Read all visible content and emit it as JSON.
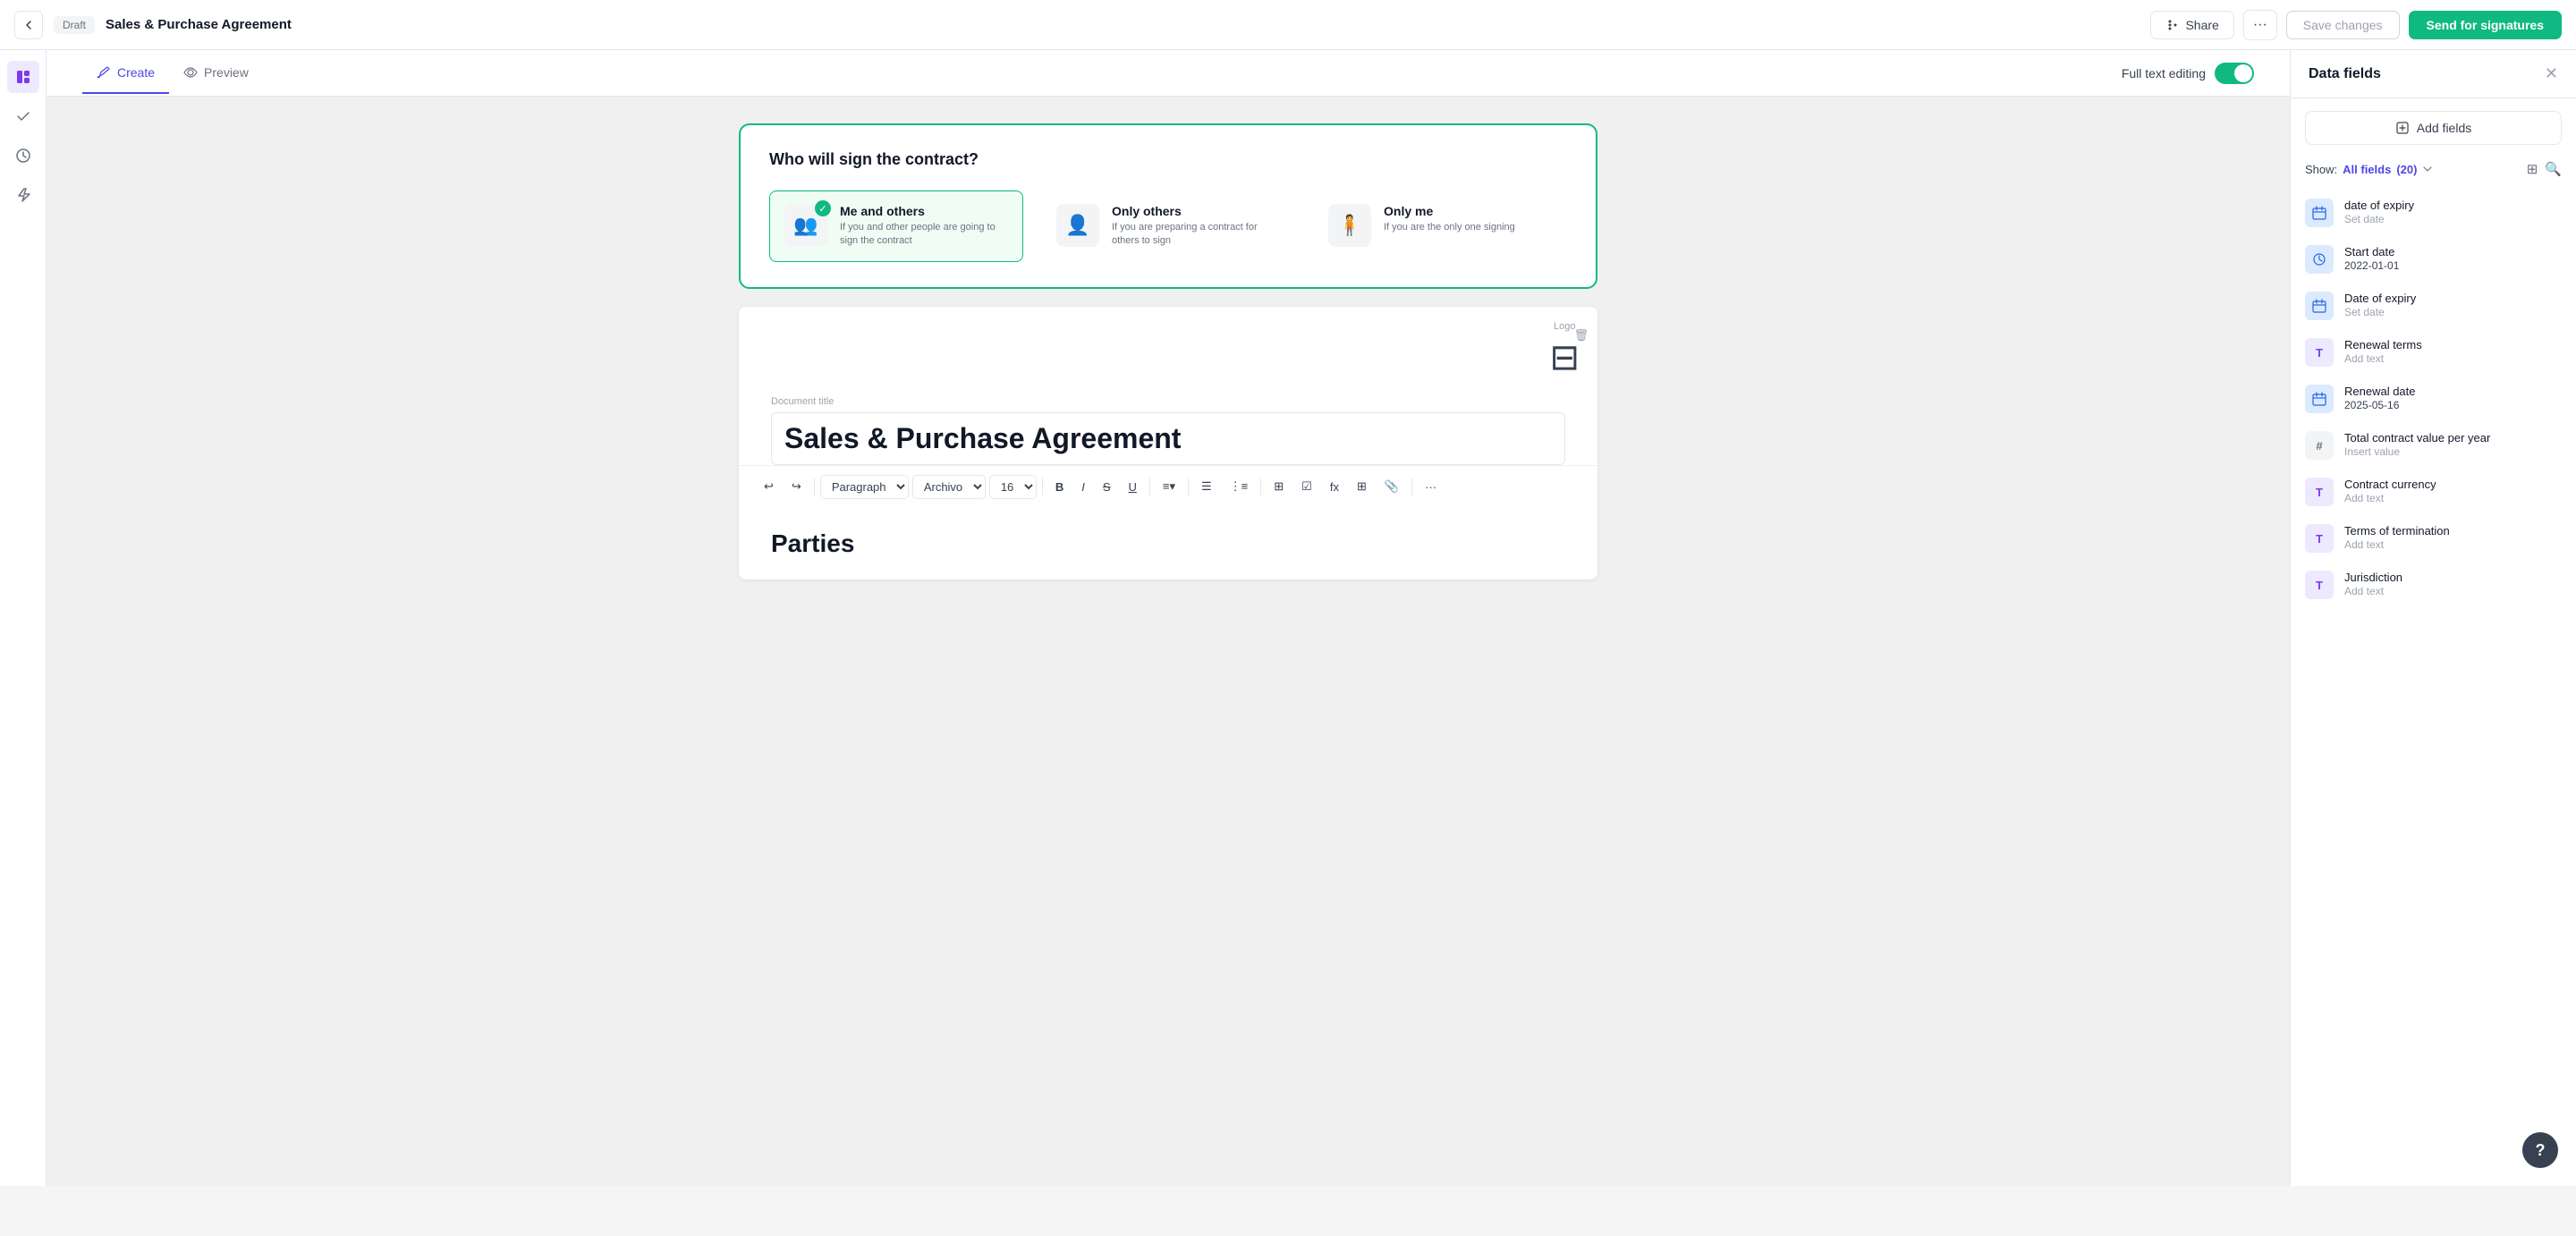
{
  "topbar": {
    "back_label": "←",
    "draft_badge": "Draft",
    "title": "Sales & Purchase Agreement",
    "share_label": "Share",
    "more_label": "···",
    "save_label": "Save changes",
    "send_label": "Send for signatures"
  },
  "tabs": {
    "create_label": "Create",
    "preview_label": "Preview",
    "full_text_label": "Full text editing"
  },
  "signer": {
    "title": "Who will sign the contract?",
    "options": [
      {
        "id": "me-and-others",
        "label": "Me and others",
        "description": "If you and other people are going to sign the contract",
        "selected": true
      },
      {
        "id": "only-others",
        "label": "Only others",
        "description": "If you are preparing a contract for others to sign",
        "selected": false
      },
      {
        "id": "only-me",
        "label": "Only me",
        "description": "If you are the only one signing",
        "selected": false
      }
    ]
  },
  "document": {
    "title_label": "Document title",
    "title_value": "Sales & Purchase Agreement",
    "logo_label": "Logo",
    "section_parties": "Parties"
  },
  "toolbar": {
    "paragraph_label": "Paragraph",
    "font_label": "Archivo",
    "size_label": "16",
    "bold_label": "B",
    "italic_label": "I",
    "strike_label": "S",
    "underline_label": "U",
    "align_label": "≡",
    "bullet_label": "≡",
    "numbered_label": "≡",
    "more_label": "···"
  },
  "right_panel": {
    "title": "Data fields",
    "add_fields_label": "Add fields",
    "show_label": "Show:",
    "all_fields_label": "All fields",
    "count": "(20)",
    "fields": [
      {
        "name": "date of expiry",
        "value": "Set date",
        "type": "date",
        "color": "blue",
        "icon": "calendar"
      },
      {
        "name": "Start date",
        "value": "2022-01-01",
        "type": "date",
        "color": "blue",
        "icon": "history",
        "has_value": true
      },
      {
        "name": "Date of expiry",
        "value": "Set date",
        "type": "date",
        "color": "blue",
        "icon": "calendar"
      },
      {
        "name": "Renewal terms",
        "value": "Add text",
        "type": "text",
        "color": "purple",
        "icon": "text"
      },
      {
        "name": "Renewal date",
        "value": "2025-05-16",
        "type": "date",
        "color": "blue",
        "icon": "calendar",
        "has_value": true
      },
      {
        "name": "Total contract value per year",
        "value": "Insert value",
        "type": "number",
        "color": "gray",
        "icon": "number"
      },
      {
        "name": "Contract currency",
        "value": "Add text",
        "type": "text",
        "color": "purple",
        "icon": "text"
      },
      {
        "name": "Terms of termination",
        "value": "Add text",
        "type": "text",
        "color": "purple",
        "icon": "text"
      },
      {
        "name": "Jurisdiction",
        "value": "Add text",
        "type": "text",
        "color": "purple",
        "icon": "text"
      }
    ]
  }
}
